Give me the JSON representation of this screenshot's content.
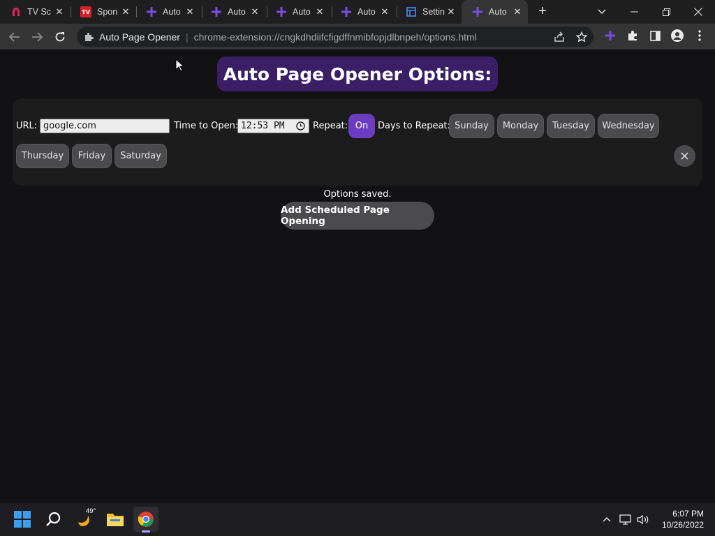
{
  "browser": {
    "tabs": [
      {
        "title": "TV Sc",
        "icon": "magnet-icon"
      },
      {
        "title": "Spon",
        "icon": "tv-guide-icon"
      },
      {
        "title": "Auto",
        "icon": "plus-icon"
      },
      {
        "title": "Auto",
        "icon": "plus-icon"
      },
      {
        "title": "Auto",
        "icon": "plus-icon"
      },
      {
        "title": "Auto",
        "icon": "plus-icon"
      },
      {
        "title": "Settin",
        "icon": "settings-doc-icon"
      },
      {
        "title": "Auto",
        "icon": "plus-icon"
      }
    ],
    "active_tab": 7,
    "omnibox": {
      "site_name": "Auto Page Opener",
      "separator": "|",
      "url": "chrome-extension://cngkdhdiifcfigdffnmibfopjdlbnpeh/options.html"
    },
    "accent_color": "#7b4ce0"
  },
  "page": {
    "title": "Auto Page Opener Options:",
    "row": {
      "url_label": "URL:",
      "url_value": "google.com",
      "time_label": "Time to Open:",
      "time_value": "12:53 PM",
      "repeat_label": "Repeat:",
      "repeat_toggle": "On",
      "days_label": "Days to Repeat:",
      "days": [
        "Sunday",
        "Monday",
        "Tuesday",
        "Wednesday",
        "Thursday",
        "Friday",
        "Saturday"
      ],
      "remove_icon": "close-icon"
    },
    "status": "Options saved.",
    "add_button": "Add Scheduled Page Opening",
    "colors": {
      "header_bg": "#3a1f66",
      "toggle_on": "#6c3dc1",
      "button_bg": "#4b4b4d"
    }
  },
  "taskbar": {
    "weather_temp": "49°",
    "time": "6:07 PM",
    "date": "10/26/2022"
  }
}
